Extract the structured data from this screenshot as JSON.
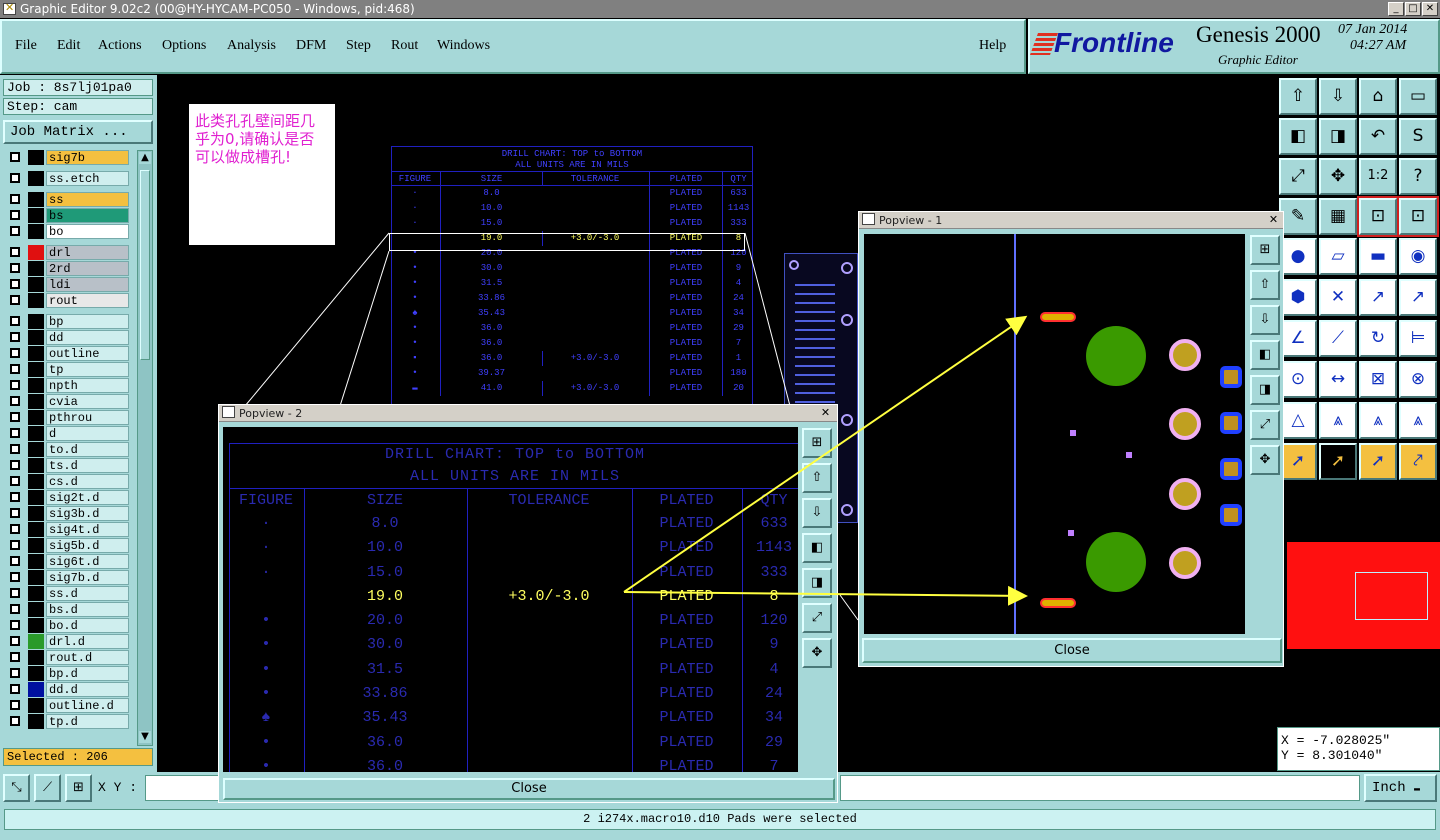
{
  "window": {
    "title": "Graphic Editor 9.02c2 (00@HY-HYCAM-PC050 - Windows, pid:468)",
    "min": "_",
    "max": "□",
    "close": "✕"
  },
  "menus": [
    "File",
    "Edit",
    "Actions",
    "Options",
    "Analysis",
    "DFM",
    "Step",
    "Rout",
    "Windows"
  ],
  "help": "Help",
  "brand": {
    "logo": "Frontline",
    "product": "Genesis 2000",
    "subtitle": "Graphic Editor",
    "date": "07 Jan 2014",
    "time": "04:27 AM"
  },
  "job": {
    "job": "Job : 8s7lj01pa0",
    "step": "Step: cam",
    "matrix_btn": "Job Matrix ..."
  },
  "layers": [
    {
      "name": "sig7b",
      "color": "#000000",
      "bg": "#f4c040"
    },
    {
      "name": "ss.etch",
      "color": "#000000",
      "bg": "#cfeeee"
    },
    {
      "name": "ss",
      "color": "#000000",
      "bg": "#f4c040"
    },
    {
      "name": "bs",
      "color": "#000000",
      "bg": "#1f9a78"
    },
    {
      "name": "bo",
      "color": "#000000",
      "bg": "#ffffff"
    },
    {
      "name": "drl",
      "color": "#e01010",
      "bg": "#b8c0c8"
    },
    {
      "name": "2rd",
      "color": "#000000",
      "bg": "#b8c0c8"
    },
    {
      "name": "ldi",
      "color": "#000000",
      "bg": "#b8c0c8"
    },
    {
      "name": "rout",
      "color": "#000000",
      "bg": "#e8e8e8"
    },
    {
      "name": "bp",
      "color": "#000000",
      "bg": "#cfeeee"
    },
    {
      "name": "dd",
      "color": "#000000",
      "bg": "#cfeeee"
    },
    {
      "name": "outline",
      "color": "#000000",
      "bg": "#cfeeee"
    },
    {
      "name": "tp",
      "color": "#000000",
      "bg": "#cfeeee"
    },
    {
      "name": "npth",
      "color": "#000000",
      "bg": "#cfeeee"
    },
    {
      "name": "cvia",
      "color": "#000000",
      "bg": "#cfeeee"
    },
    {
      "name": "pthrou",
      "color": "#000000",
      "bg": "#cfeeee"
    },
    {
      "name": "d",
      "color": "#000000",
      "bg": "#cfeeee"
    },
    {
      "name": "to.d",
      "color": "#000000",
      "bg": "#cfeeee"
    },
    {
      "name": "ts.d",
      "color": "#000000",
      "bg": "#cfeeee"
    },
    {
      "name": "cs.d",
      "color": "#000000",
      "bg": "#cfeeee"
    },
    {
      "name": "sig2t.d",
      "color": "#000000",
      "bg": "#cfeeee"
    },
    {
      "name": "sig3b.d",
      "color": "#000000",
      "bg": "#cfeeee"
    },
    {
      "name": "sig4t.d",
      "color": "#000000",
      "bg": "#cfeeee"
    },
    {
      "name": "sig5b.d",
      "color": "#000000",
      "bg": "#cfeeee"
    },
    {
      "name": "sig6t.d",
      "color": "#000000",
      "bg": "#cfeeee"
    },
    {
      "name": "sig7b.d",
      "color": "#000000",
      "bg": "#cfeeee"
    },
    {
      "name": "ss.d",
      "color": "#000000",
      "bg": "#cfeeee"
    },
    {
      "name": "bs.d",
      "color": "#000000",
      "bg": "#cfeeee"
    },
    {
      "name": "bo.d",
      "color": "#000000",
      "bg": "#cfeeee"
    },
    {
      "name": "drl.d",
      "color": "#2a9a2a",
      "bg": "#cfeeee"
    },
    {
      "name": "rout.d",
      "color": "#000000",
      "bg": "#cfeeee"
    },
    {
      "name": "bp.d",
      "color": "#000000",
      "bg": "#cfeeee"
    },
    {
      "name": "dd.d",
      "color": "#0010a0",
      "bg": "#cfeeee"
    },
    {
      "name": "outline.d",
      "color": "#000000",
      "bg": "#cfeeee"
    },
    {
      "name": "tp.d",
      "color": "#000000",
      "bg": "#cfeeee"
    }
  ],
  "selected": "Selected : 206",
  "note": "此类孔孔壁间距几乎为0,请确认是否可以做成槽孔!",
  "drill_chart": {
    "title": "DRILL CHART: TOP to BOTTOM",
    "subtitle": "ALL UNITS ARE IN MILS",
    "headers": [
      "FIGURE",
      "SIZE",
      "TOLERANCE",
      "PLATED",
      "QTY"
    ],
    "rows": [
      {
        "fig": "·",
        "size": "8.0",
        "tol": "",
        "plated": "PLATED",
        "qty": "633"
      },
      {
        "fig": "·",
        "size": "10.0",
        "tol": "",
        "plated": "PLATED",
        "qty": "1143"
      },
      {
        "fig": "·",
        "size": "15.0",
        "tol": "",
        "plated": "PLATED",
        "qty": "333"
      },
      {
        "fig": "",
        "size": "19.0",
        "tol": "+3.0/-3.0",
        "plated": "PLATED",
        "qty": "8"
      },
      {
        "fig": "•",
        "size": "20.0",
        "tol": "",
        "plated": "PLATED",
        "qty": "120"
      },
      {
        "fig": "•",
        "size": "30.0",
        "tol": "",
        "plated": "PLATED",
        "qty": "9"
      },
      {
        "fig": "•",
        "size": "31.5",
        "tol": "",
        "plated": "PLATED",
        "qty": "4"
      },
      {
        "fig": "•",
        "size": "33.86",
        "tol": "",
        "plated": "PLATED",
        "qty": "24"
      },
      {
        "fig": "♠",
        "size": "35.43",
        "tol": "",
        "plated": "PLATED",
        "qty": "34"
      },
      {
        "fig": "•",
        "size": "36.0",
        "tol": "",
        "plated": "PLATED",
        "qty": "29"
      },
      {
        "fig": "•",
        "size": "36.0",
        "tol": "",
        "plated": "PLATED",
        "qty": "7"
      },
      {
        "fig": "▪",
        "size": "36.0",
        "tol": "+3.0/-3.0",
        "plated": "PLATED",
        "qty": "1"
      },
      {
        "fig": "•",
        "size": "39.37",
        "tol": "",
        "plated": "PLATED",
        "qty": "180"
      },
      {
        "fig": "▬",
        "size": "41.0",
        "tol": "+3.0/-3.0",
        "plated": "PLATED",
        "qty": "20"
      }
    ]
  },
  "popview1": {
    "title": "Popview - 1",
    "close": "Close"
  },
  "popview2": {
    "title": "Popview - 2",
    "close": "Close"
  },
  "coords": {
    "x": "X = -7.028025\"",
    "y": "Y = 8.301040\""
  },
  "xy_label": "X Y :",
  "units": "Inch",
  "status": "2 i274x.macro10.d10 Pads were selected"
}
